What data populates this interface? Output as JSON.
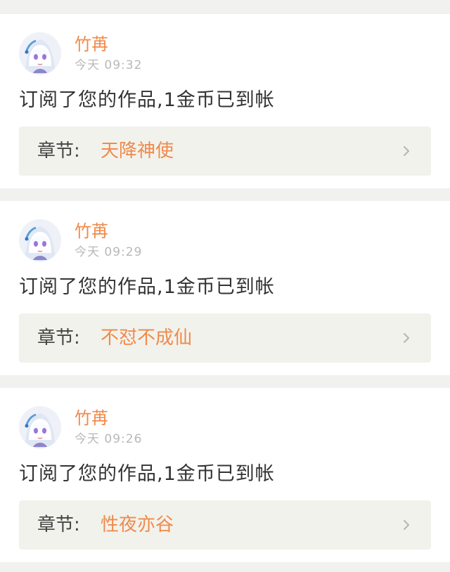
{
  "notifications": [
    {
      "user_name": "竹苒",
      "time": "今天 09:32",
      "message": "订阅了您的作品,1金币已到帐",
      "chapter_prefix": "章节:",
      "chapter_title": "天降神使",
      "chevron": "chevron-right-icon"
    },
    {
      "user_name": "竹苒",
      "time": "今天 09:29",
      "message": "订阅了您的作品,1金币已到帐",
      "chapter_prefix": "章节:",
      "chapter_title": "不怼不成仙",
      "chevron": "chevron-right-icon"
    },
    {
      "user_name": "竹苒",
      "time": "今天 09:26",
      "message": "订阅了您的作品,1金币已到帐",
      "chapter_prefix": "章节:",
      "chapter_title": "性夜亦谷",
      "chevron": "chevron-right-icon"
    }
  ],
  "colors": {
    "accent": "#f08a4b",
    "muted_text": "#b8b8b8",
    "body_text": "#333333",
    "chapter_bg": "#f2f2ec",
    "page_bg": "#f1f1ef"
  }
}
